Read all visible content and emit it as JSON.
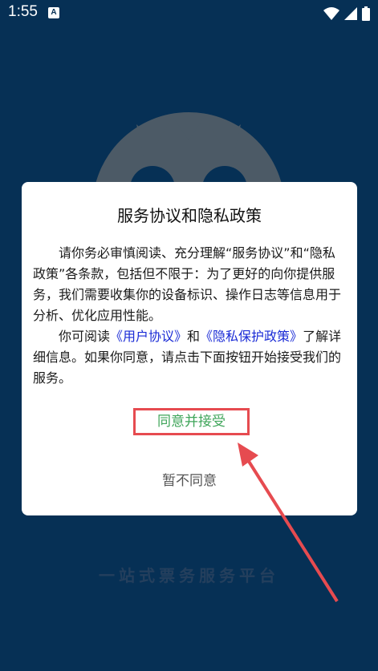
{
  "status_bar": {
    "time": "1:55",
    "notification_icon_letter": "A",
    "icons": [
      "wifi-icon",
      "signal-icon",
      "battery-icon"
    ]
  },
  "background": {
    "slogan": "一站式票务服务平台",
    "logo_icon": "mascot-logo-icon"
  },
  "dialog": {
    "title": "服务协议和隐私政策",
    "paragraph1": "请你务必审慎阅读、充分理解“服务协议”和“隐私政策”各条款，包括但不限于：为了更好的向你提供服务，我们需要收集你的设备标识、操作日志等信息用于分析、优化应用性能。",
    "paragraph2_prefix": "你可阅读",
    "user_agreement_link": "《用户协议》",
    "paragraph2_and": "和",
    "privacy_policy_link": "《隐私保护政策》",
    "paragraph2_suffix": "了解详细信息。如果你同意，请点击下面按钮开始接受我们的服务。",
    "agree_label": "同意并接受",
    "disagree_label": "暂不同意"
  },
  "colors": {
    "background": "#063055",
    "dialog_bg": "#ffffff",
    "agree_text": "#3fa55a",
    "highlight_border": "#e64b50",
    "link": "#1a2bd6"
  }
}
